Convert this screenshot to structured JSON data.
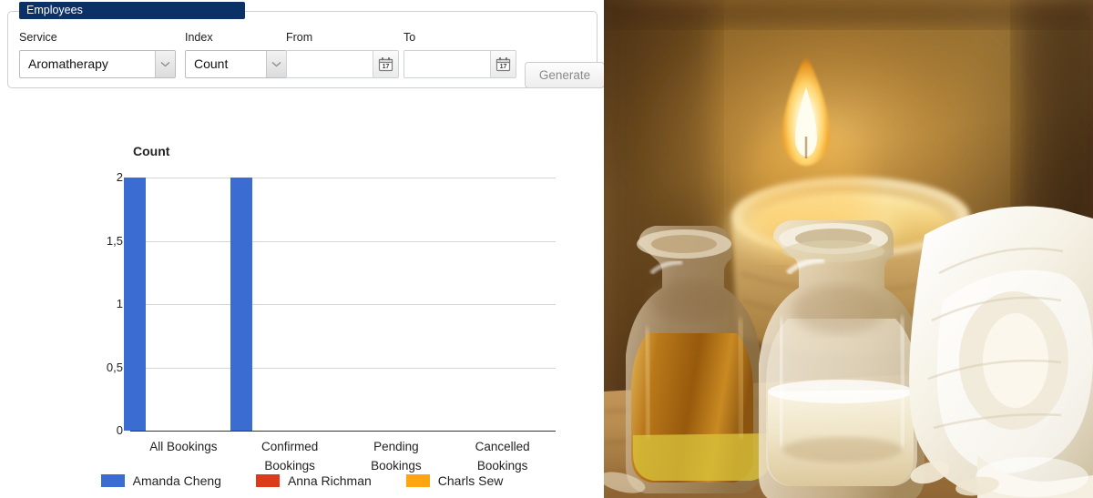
{
  "panel": {
    "legend_title": "Employees"
  },
  "form": {
    "service": {
      "label": "Service",
      "value": "Aromatherapy"
    },
    "index": {
      "label": "Index",
      "value": "Count"
    },
    "from": {
      "label": "From",
      "value": "",
      "placeholder": ""
    },
    "to": {
      "label": "To",
      "value": "",
      "placeholder": ""
    },
    "calendar_icon_day": "17",
    "generate_label": "Generate"
  },
  "chart_data": {
    "type": "bar",
    "title": "Count",
    "xlabel": "",
    "ylabel": "",
    "categories": [
      "All Bookings",
      "Confirmed Bookings",
      "Pending Bookings",
      "Cancelled Bookings"
    ],
    "category_lines": [
      [
        "All Bookings"
      ],
      [
        "Confirmed",
        "Bookings"
      ],
      [
        "Pending",
        "Bookings"
      ],
      [
        "Cancelled",
        "Bookings"
      ]
    ],
    "series": [
      {
        "name": "Amanda Cheng",
        "color": "#3a6cd1",
        "values": [
          2,
          2,
          0,
          0
        ]
      },
      {
        "name": "Anna Richman",
        "color": "#db3b1b",
        "values": [
          0,
          0,
          0,
          0
        ]
      },
      {
        "name": "Charls Sew",
        "color": "#ffa412",
        "values": [
          0,
          0,
          0,
          0
        ]
      }
    ],
    "ylim": [
      0,
      2
    ],
    "yticks": [
      0,
      0.5,
      1,
      1.5,
      2
    ],
    "ytick_labels": [
      "0",
      "0,5",
      "1",
      "1,5",
      "2"
    ],
    "grid": true,
    "legend_position": "bottom"
  },
  "photo": {
    "alt": "Spa still life with lit candle, two essential oil bottles and a rolled white towel on a wooden surface",
    "colors": {
      "background_wood": "#7a5422",
      "candle_flame": "#ffe9a8",
      "candle_wax": "#f6d98a",
      "amber_oil": "#c98a1e",
      "towel": "#f3efe4",
      "table": "#c79a5c"
    }
  }
}
